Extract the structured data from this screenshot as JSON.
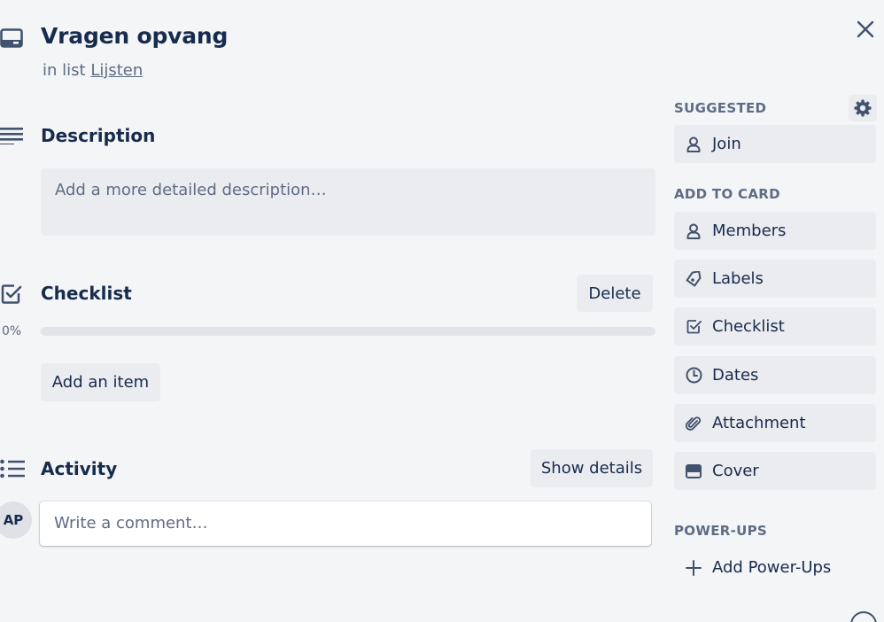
{
  "card": {
    "title": "Vragen opvang",
    "in_list_prefix": "in list",
    "list_name": "Lijsten"
  },
  "description": {
    "title": "Description",
    "placeholder": "Add a more detailed description…"
  },
  "checklist": {
    "title": "Checklist",
    "delete_label": "Delete",
    "progress_label": "0%",
    "progress": 0,
    "add_item_label": "Add an item"
  },
  "activity": {
    "title": "Activity",
    "show_details_label": "Show details",
    "comment_placeholder": "Write a comment…",
    "avatar_initials": "AP"
  },
  "sidebar": {
    "suggested_heading": "SUGGESTED",
    "join_label": "Join",
    "add_to_card_heading": "ADD TO CARD",
    "add_to_card": [
      {
        "label": "Members",
        "icon": "person-icon"
      },
      {
        "label": "Labels",
        "icon": "tag-icon"
      },
      {
        "label": "Checklist",
        "icon": "checklist-icon"
      },
      {
        "label": "Dates",
        "icon": "clock-icon"
      },
      {
        "label": "Attachment",
        "icon": "paperclip-icon"
      },
      {
        "label": "Cover",
        "icon": "cover-icon"
      }
    ],
    "powerups_heading": "POWER-UPS",
    "add_powerups_label": "Add Power-Ups"
  },
  "colors": {
    "background": "#f4f5f7",
    "button_bg": "#ebecf0",
    "text_primary": "#172b4d",
    "text_subtle": "#5e6c84"
  }
}
